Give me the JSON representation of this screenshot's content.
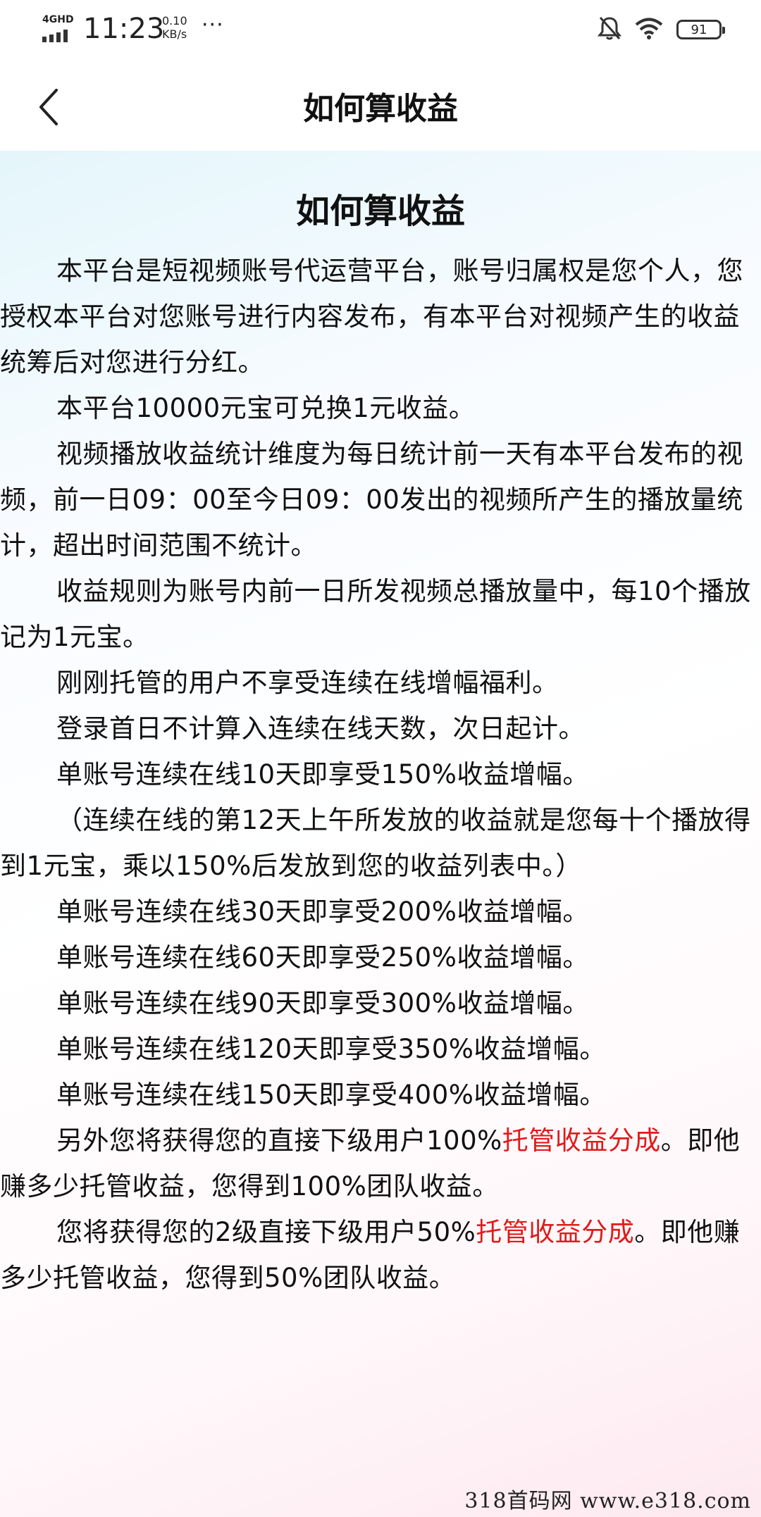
{
  "status_bar": {
    "network": "4GHD",
    "time": "11:23",
    "speed_value": "0.10",
    "speed_unit": "KB/s",
    "more": "···",
    "battery": "91",
    "icons": [
      "signal-icon",
      "mute-bell-icon",
      "wifi-icon",
      "battery-icon"
    ]
  },
  "nav": {
    "title": "如何算收益",
    "back_icon": "chevron-left-icon"
  },
  "article": {
    "title": "如何算收益",
    "paragraphs": [
      "本平台是短视频账号代运营平台，账号归属权是您个人，您授权本平台对您账号进行内容发布，有本平台对视频产生的收益统筹后对您进行分红。",
      "本平台10000元宝可兑换1元收益。",
      "视频播放收益统计维度为每日统计前一天有本平台发布的视频，前一日09：00至今日09：00发出的视频所产生的播放量统计，超出时间范围不统计。",
      "收益规则为账号内前一日所发视频总播放量中，每10个播放记为1元宝。",
      "刚刚托管的用户不享受连续在线增幅福利。",
      "登录首日不计算入连续在线天数，次日起计。",
      "单账号连续在线10天即享受150%收益增幅。",
      "（连续在线的第12天上午所发放的收益就是您每十个播放得到1元宝，乘以150%后发放到您的收益列表中。）",
      "单账号连续在线30天即享受200%收益增幅。",
      "单账号连续在线60天即享受250%收益增幅。",
      "单账号连续在线90天即享受300%收益增幅。",
      "单账号连续在线120天即享受350%收益增幅。",
      "单账号连续在线150天即享受400%收益增幅。"
    ],
    "p14": {
      "before": "另外您将获得您的直接下级用户100%",
      "highlight": "托管收益分成",
      "after": "。即他赚多少托管收益，您得到100%团队收益。"
    },
    "p15": {
      "before": "您将获得您的2级直接下级用户50%",
      "highlight": "托管收益分成",
      "after": "。即他赚多少托管收益，您得到50%团队收益。"
    }
  },
  "watermark": "318首码网   www.e318.com",
  "colors": {
    "highlight": "#e01b1b",
    "text": "#111111"
  }
}
